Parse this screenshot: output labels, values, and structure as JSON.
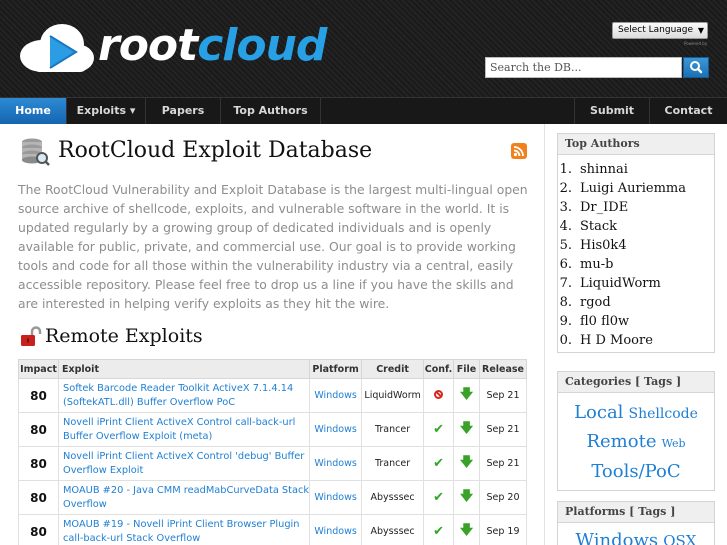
{
  "site": {
    "name_part1": "root",
    "name_part2": "cloud"
  },
  "header": {
    "language_select": "Select Language",
    "powered_by": "Powered by",
    "search_placeholder": "Search the DB..."
  },
  "nav": {
    "items": [
      {
        "label": "Home",
        "active": true
      },
      {
        "label": "Exploits ▾"
      },
      {
        "label": "Papers"
      },
      {
        "label": "Top Authors"
      },
      {
        "label": "Submit"
      },
      {
        "label": "Contact"
      }
    ]
  },
  "main": {
    "title": "RootCloud Exploit Database",
    "intro": "The RootCloud Vulnerability and Exploit Database is the largest multi-lingual open source archive of shellcode, exploits, and vulnerable software in the world. It is updated regularly by a growing group of dedicated individuals and is openly available for public, private, and commercial use. Our goal is to provide working tools and code for all those within the vulnerability industry via a central, easily accessible repository. Please feel free to drop us a line if you have the skills and are interested in helping verify exploits as they hit the wire.",
    "section_title": "Remote Exploits",
    "table": {
      "headers": [
        "Impact",
        "Exploit",
        "Platform",
        "Credit",
        "Conf.",
        "File",
        "Release"
      ],
      "rows": [
        {
          "impact": "80",
          "exploit": "Softek Barcode Reader Toolkit ActiveX 7.1.4.14 (SoftekATL.dll) Buffer Overflow PoC",
          "platform": "Windows",
          "credit": "LiquidWorm",
          "conf": "no",
          "release": "Sep 21"
        },
        {
          "impact": "80",
          "exploit": "Novell iPrint Client ActiveX Control call-back-url Buffer Overflow Exploit (meta)",
          "platform": "Windows",
          "credit": "Trancer",
          "conf": "yes",
          "release": "Sep 21"
        },
        {
          "impact": "80",
          "exploit": "Novell iPrint Client ActiveX Control 'debug' Buffer Overflow Exploit",
          "platform": "Windows",
          "credit": "Trancer",
          "conf": "yes",
          "release": "Sep 21"
        },
        {
          "impact": "80",
          "exploit": "MOAUB #20 - Java CMM readMabCurveData Stack Overflow",
          "platform": "Windows",
          "credit": "Abysssec",
          "conf": "yes",
          "release": "Sep 20"
        },
        {
          "impact": "80",
          "exploit": "MOAUB #19 - Novell iPrint Client Browser Plugin call-back-url Stack Overflow",
          "platform": "Windows",
          "credit": "Abysssec",
          "conf": "yes",
          "release": "Sep 19"
        }
      ]
    }
  },
  "sidebar": {
    "top_authors_title": "Top Authors",
    "authors": [
      {
        "num": "1.",
        "name": "shinnai"
      },
      {
        "num": "2.",
        "name": "Luigi Auriemma"
      },
      {
        "num": "3.",
        "name": "Dr_IDE"
      },
      {
        "num": "4.",
        "name": "Stack"
      },
      {
        "num": "5.",
        "name": "His0k4"
      },
      {
        "num": "6.",
        "name": "mu-b"
      },
      {
        "num": "7.",
        "name": "LiquidWorm"
      },
      {
        "num": "8.",
        "name": "rgod"
      },
      {
        "num": "9.",
        "name": "fl0 fl0w"
      },
      {
        "num": "0.",
        "name": "H D Moore"
      }
    ],
    "categories_title": "Categories [ Tags ]",
    "categories": {
      "local": "Local",
      "shellcode": "Shellcode",
      "remote": "Remote",
      "web": "Web",
      "tools": "Tools/PoC"
    },
    "platforms_title": "Platforms [ Tags ]",
    "platforms": {
      "windows": "Windows",
      "osx": "OSX"
    }
  },
  "colors": {
    "accent": "#1f7fd4",
    "nav_active": "#1f75c3",
    "header_bg": "#1e1e1e"
  }
}
